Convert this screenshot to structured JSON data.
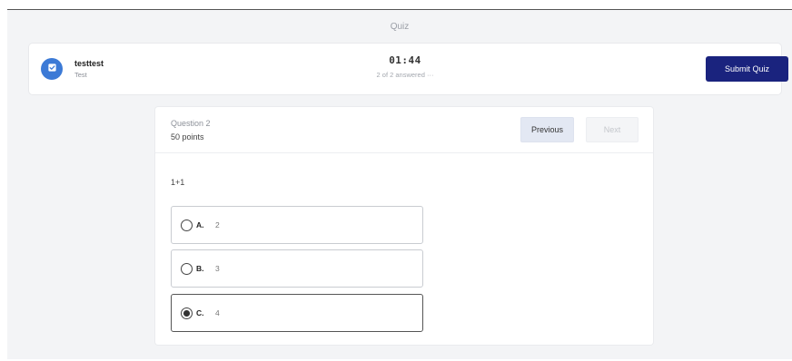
{
  "page": {
    "title": "Quiz"
  },
  "user": {
    "name": "testtest",
    "subtitle": "Test",
    "avatar_icon": "clipboard-check-icon",
    "avatar_color": "#3c7ad6"
  },
  "timer": {
    "value": "01:44"
  },
  "progress": {
    "text": "2 of 2 answered",
    "more_icon": "ellipsis-icon",
    "more_glyph": "···"
  },
  "actions": {
    "submit_label": "Submit Quiz",
    "submit_color": "#1a237e"
  },
  "question": {
    "number_label": "Question 2",
    "points_label": "50 points",
    "text": "1+1",
    "nav": {
      "previous_label": "Previous",
      "next_label": "Next"
    },
    "options": [
      {
        "letter": "A.",
        "value": "2",
        "selected": false
      },
      {
        "letter": "B.",
        "value": "3",
        "selected": false
      },
      {
        "letter": "C.",
        "value": "4",
        "selected": true
      }
    ]
  }
}
